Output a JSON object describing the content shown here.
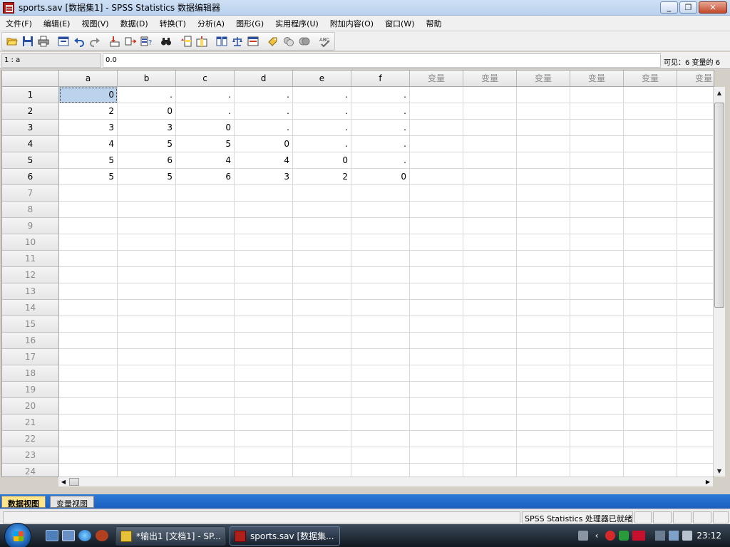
{
  "window": {
    "title": "sports.sav [数据集1] - SPSS Statistics 数据编辑器",
    "minimize": "_",
    "restore": "❐",
    "close": "✕"
  },
  "menu": [
    "文件(F)",
    "编辑(E)",
    "视图(V)",
    "数据(D)",
    "转换(T)",
    "分析(A)",
    "图形(G)",
    "实用程序(U)",
    "附加内容(O)",
    "窗口(W)",
    "帮助"
  ],
  "cellbar": {
    "ref": "1 : a",
    "value": "0.0",
    "visible": "可见：6 变量的 6"
  },
  "grid": {
    "columns": [
      "a",
      "b",
      "c",
      "d",
      "e",
      "f",
      "变量",
      "变量",
      "变量",
      "变量",
      "变量",
      "变量"
    ],
    "row_numbers": [
      "1",
      "2",
      "3",
      "4",
      "5",
      "6",
      "7",
      "8",
      "9",
      "10",
      "11",
      "12",
      "13",
      "14",
      "15",
      "16",
      "17",
      "18",
      "19",
      "20",
      "21",
      "22",
      "23",
      "24"
    ],
    "rows": [
      [
        "0",
        ".",
        ".",
        ".",
        ".",
        "."
      ],
      [
        "2",
        "0",
        ".",
        ".",
        ".",
        "."
      ],
      [
        "3",
        "3",
        "0",
        ".",
        ".",
        "."
      ],
      [
        "4",
        "5",
        "5",
        "0",
        ".",
        "."
      ],
      [
        "5",
        "6",
        "4",
        "4",
        "0",
        "."
      ],
      [
        "5",
        "5",
        "6",
        "3",
        "2",
        "0"
      ]
    ]
  },
  "tabs": {
    "data_view": "数据视图",
    "variable_view": "变量视图"
  },
  "status": {
    "text": "SPSS Statistics  处理器已就绪"
  },
  "taskbar": {
    "tasks": [
      "*输出1 [文档1] - SP...",
      "sports.sav [数据集..."
    ],
    "clock": "23:12"
  },
  "colors": {
    "selected_cell": "#bcd3ee",
    "active_tab": "#ffe58a",
    "tab_strip": "#1b5fbf"
  }
}
